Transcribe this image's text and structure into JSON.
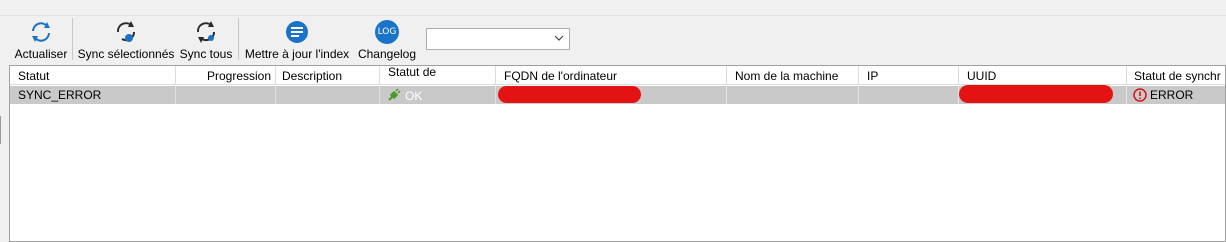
{
  "toolbar": {
    "buttons": [
      {
        "label": "Actualiser",
        "icon": "refresh-icon"
      },
      {
        "label": "Sync sélectionnés",
        "icon": "sync-selected-icon"
      },
      {
        "label": "Sync tous",
        "icon": "sync-all-icon"
      },
      {
        "label": "Mettre à jour l'index",
        "icon": "update-index-icon"
      },
      {
        "label": "Changelog",
        "icon": "log-icon",
        "icon_text": "LOG"
      }
    ],
    "dropdown": {
      "value": ""
    }
  },
  "table": {
    "columns": [
      "Statut",
      "Progression",
      "Description",
      "Statut de",
      "FQDN de l'ordinateur",
      "Nom de la machine",
      "IP",
      "UUID",
      "Statut de synchr"
    ],
    "rows": [
      {
        "statut": "SYNC_ERROR",
        "progression": "",
        "description": "",
        "statut_de": "OK",
        "fqdn": "",
        "nom_machine": "",
        "ip": "",
        "uuid": "",
        "statut_synchr": "ERROR"
      }
    ]
  },
  "colors": {
    "accent": "#1a73c8",
    "row_selected": "#c9c9c9",
    "error": "#d21414",
    "ok_icon": "#4a9a2a",
    "redaction": "#e41313"
  }
}
